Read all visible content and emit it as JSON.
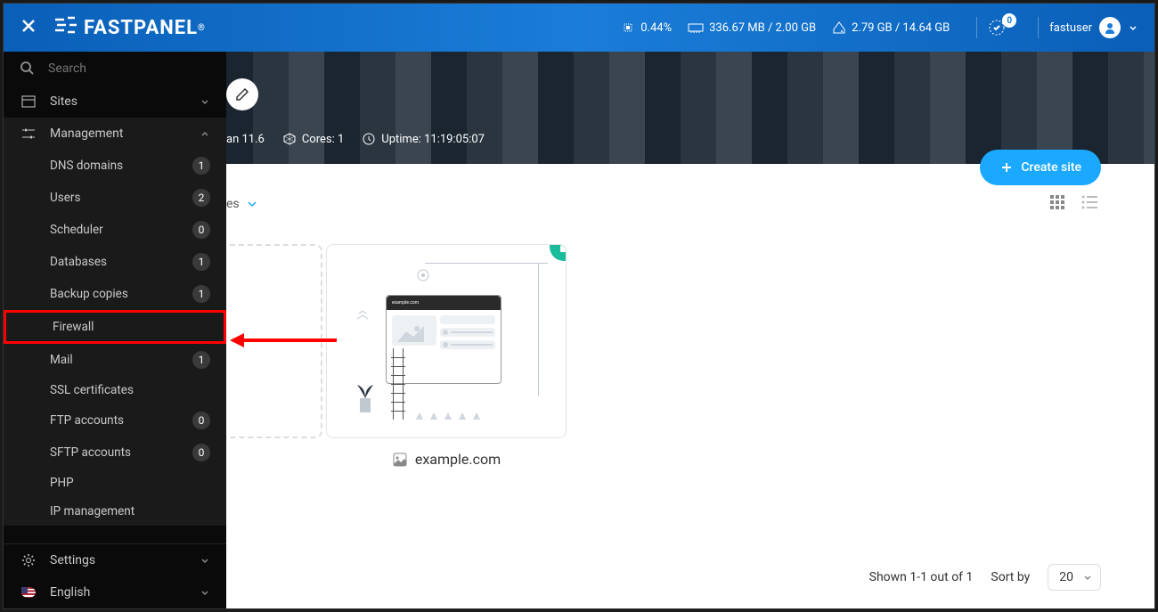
{
  "header": {
    "logo_text": "FASTPANEL",
    "cpu_percent": "0.44%",
    "memory": "336.67 MB / 2.00 GB",
    "disk": "2.79 GB / 14.64 GB",
    "notifications": "0",
    "username": "fastuser"
  },
  "sidebar": {
    "search_placeholder": "Search",
    "sites_label": "Sites",
    "management_label": "Management",
    "management_items": [
      {
        "label": "DNS domains",
        "count": "1"
      },
      {
        "label": "Users",
        "count": "2"
      },
      {
        "label": "Scheduler",
        "count": "0"
      },
      {
        "label": "Databases",
        "count": "1"
      },
      {
        "label": "Backup copies",
        "count": "1"
      },
      {
        "label": "Firewall",
        "count": null
      },
      {
        "label": "Mail",
        "count": "1"
      },
      {
        "label": "SSL certificates",
        "count": null
      },
      {
        "label": "FTP accounts",
        "count": "0"
      },
      {
        "label": "SFTP accounts",
        "count": "0"
      },
      {
        "label": "PHP",
        "count": null
      },
      {
        "label": "IP management",
        "count": null
      }
    ],
    "settings_label": "Settings",
    "language_label": "English"
  },
  "banner": {
    "os_suffix": "an 11.6",
    "cores": "Cores: 1",
    "uptime": "Uptime: 11:19:05:07"
  },
  "content": {
    "create_button": "Create site",
    "filter_suffix": "es",
    "site_name": "example.com",
    "mini_url": "example.com",
    "shown_text": "Shown 1-1 out of 1",
    "sort_label": "Sort by",
    "sort_value": "20"
  }
}
